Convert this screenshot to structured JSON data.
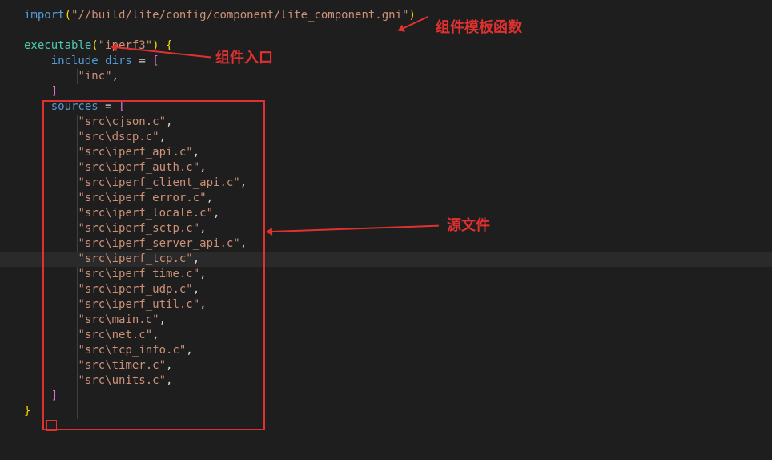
{
  "code": {
    "import_kw": "import",
    "import_path": "\"//build/lite/config/component/lite_component.gni\"",
    "executable_kw": "executable",
    "executable_arg": "\"iperf3\"",
    "include_dirs_kw": "include_dirs",
    "include_dirs_val": "\"inc\"",
    "sources_kw": "sources",
    "sources": [
      "\"src\\cjson.c\"",
      "\"src\\dscp.c\"",
      "\"src\\iperf_api.c\"",
      "\"src\\iperf_auth.c\"",
      "\"src\\iperf_client_api.c\"",
      "\"src\\iperf_error.c\"",
      "\"src\\iperf_locale.c\"",
      "\"src\\iperf_sctp.c\"",
      "\"src\\iperf_server_api.c\"",
      "\"src\\iperf_tcp.c\"",
      "\"src\\iperf_time.c\"",
      "\"src\\iperf_udp.c\"",
      "\"src\\iperf_util.c\"",
      "\"src\\main.c\"",
      "\"src\\net.c\"",
      "\"src\\tcp_info.c\"",
      "\"src\\timer.c\"",
      "\"src\\units.c\""
    ]
  },
  "annotations": {
    "template_fn": "组件模板函数",
    "entry": "组件入口",
    "source_files": "源文件"
  }
}
